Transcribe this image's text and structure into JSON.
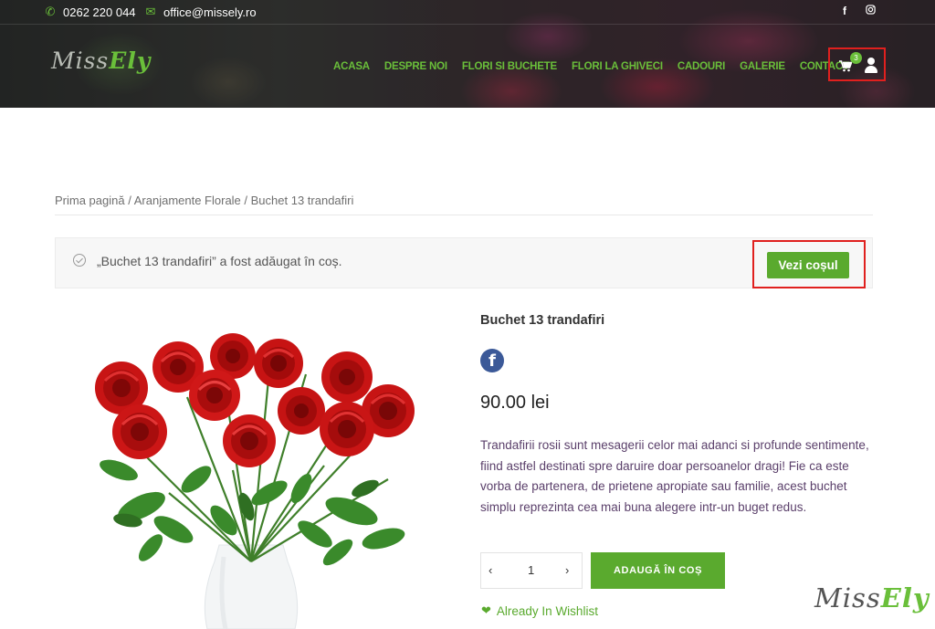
{
  "topbar": {
    "phone": "0262 220 044",
    "email": "office@missely.ro",
    "social": [
      "facebook-icon",
      "instagram-icon"
    ]
  },
  "logo": {
    "part1": "Miss",
    "part2": "Ely"
  },
  "nav": {
    "items": [
      "ACASA",
      "DESPRE NOI",
      "FLORI SI BUCHETE",
      "FLORI LA GHIVECI",
      "CADOURI",
      "GALERIE",
      "CONTACT"
    ]
  },
  "cart": {
    "count": "3"
  },
  "breadcrumb": {
    "home": "Prima pagină",
    "category": "Aranjamente Florale",
    "current": "Buchet 13 trandafiri",
    "separator": " / "
  },
  "notice": {
    "message": "„Buchet 13 trandafiri” a fost adăugat în coș.",
    "button": "Vezi coșul"
  },
  "product": {
    "title": "Buchet 13 trandafiri",
    "price": "90.00 lei",
    "description": "Trandafirii rosii sunt mesagerii celor mai adanci si profunde sentimente, fiind astfel destinati spre daruire doar persoanelor dragi! Fie ca este vorba de partenera, de prietene apropiate sau familie, acest buchet simplu reprezinta cea mai buna alegere intr-un buget redus.",
    "quantity": "1",
    "add_to_cart": "ADAUGĂ ÎN COȘ",
    "wishlist": "Already In Wishlist"
  },
  "watermark": {
    "part1": "Miss",
    "part2": "Ely"
  },
  "colors": {
    "accent": "#5aaa2e",
    "highlight": "#e0201e",
    "facebook": "#3b5998"
  }
}
